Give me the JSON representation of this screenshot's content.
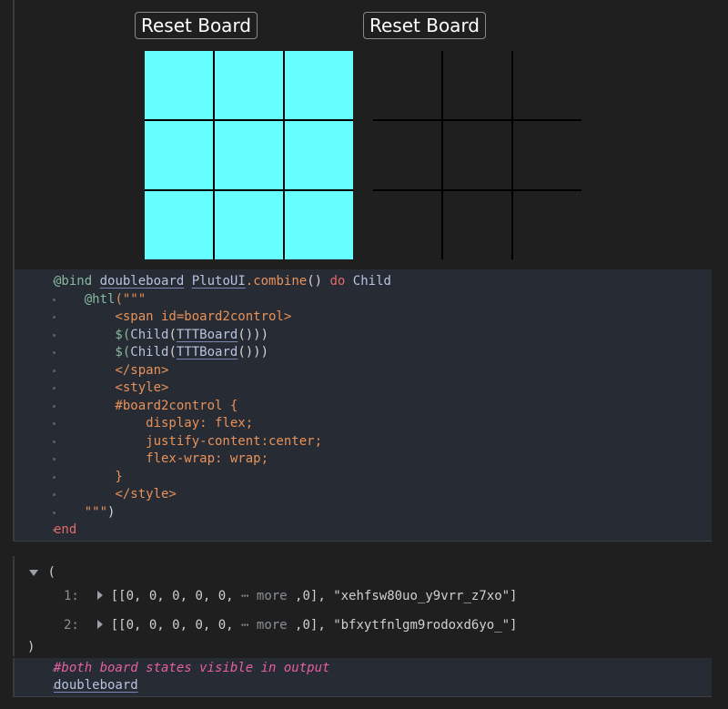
{
  "output": {
    "reset_label_left": "Reset Board",
    "reset_label_right": "Reset Board",
    "board_left_fill": "#66ffff",
    "board_right_fill": "#1f1f1f"
  },
  "code": {
    "lines": [
      [
        "@bind",
        " ",
        "doubleboard",
        " ",
        "PlutoUI",
        ".combine",
        "()",
        " do ",
        "Child"
      ],
      [
        "    @htl",
        "(\"\"\""
      ],
      [
        "        <span id=board2control>"
      ],
      [
        "        $(",
        "Child",
        "(",
        "TTTBoard",
        "()))"
      ],
      [
        "        $(",
        "Child",
        "(",
        "TTTBoard",
        "()))"
      ],
      [
        "        </span>"
      ],
      [
        "        <style>"
      ],
      [
        "        #board2control {"
      ],
      [
        "            display: flex;"
      ],
      [
        "            justify-content:center;"
      ],
      [
        "            flex-wrap: wrap;"
      ],
      [
        "        }"
      ],
      [
        "        </style>"
      ],
      [
        "    \"\"\"",
        ")"
      ],
      [
        "end"
      ]
    ]
  },
  "tuple_output": {
    "open": "(",
    "close": ")",
    "items": [
      {
        "index": "1:",
        "array": "[[0, 0, 0, 0, 0, ",
        "more": "⋯ more",
        "tail": " ,0], ",
        "id": "\"xehfsw80uo_y9vrr_z7xo\"]"
      },
      {
        "index": "2:",
        "array": "[[0, 0, 0, 0, 0, ",
        "more": "⋯ more",
        "tail": " ,0], ",
        "id": "\"bfxytfnlgm9rodoxd6yo_\"]"
      }
    ]
  },
  "code2": {
    "comment": "#both board states visible in output",
    "ident": "doubleboard"
  }
}
